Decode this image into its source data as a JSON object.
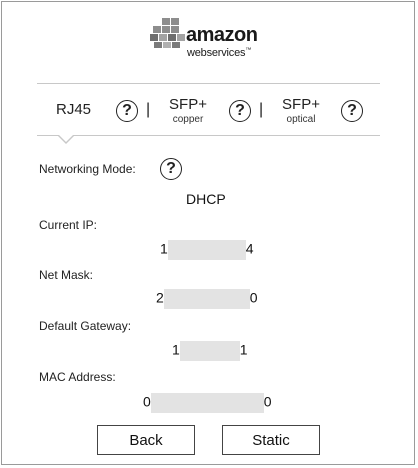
{
  "brand": {
    "name": "amazon",
    "tagline": "webservices",
    "tm": "™"
  },
  "tabs": [
    {
      "label": "RJ45",
      "sub": ""
    },
    {
      "label": "SFP+",
      "sub": "copper"
    },
    {
      "label": "SFP+",
      "sub": "optical"
    }
  ],
  "help_glyph": "?",
  "separator": "|",
  "networking": {
    "mode_label": "Networking Mode:",
    "mode_value": "DHCP",
    "current_ip_label": "Current IP:",
    "current_ip_start": "1",
    "current_ip_end": "4",
    "net_mask_label": "Net Mask:",
    "net_mask_start": "2",
    "net_mask_end": "0",
    "gateway_label": "Default Gateway:",
    "gateway_start": "1",
    "gateway_end": "1",
    "mac_label": "MAC Address:",
    "mac_start": "0",
    "mac_end": "0"
  },
  "buttons": {
    "back": "Back",
    "static": "Static"
  }
}
